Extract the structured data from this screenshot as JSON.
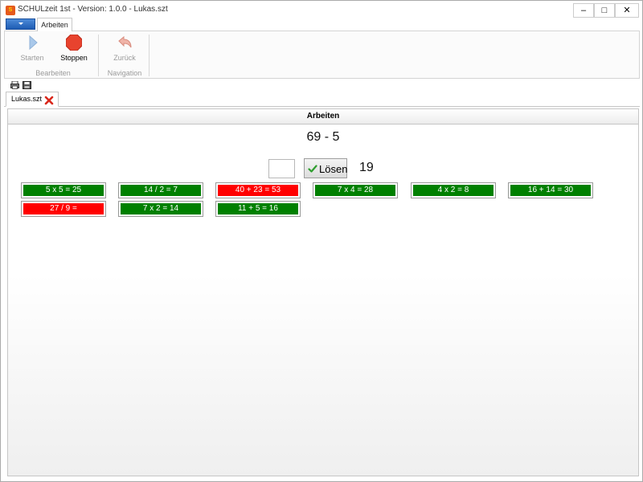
{
  "window": {
    "icon_text": "S",
    "title": "SCHULzeit 1st - Version: 1.0.0 - Lukas.szt",
    "min_glyph": "–",
    "max_glyph": "□",
    "close_glyph": "✕"
  },
  "ribbon": {
    "tab": "Arbeiten",
    "buttons": {
      "start": "Starten",
      "stop": "Stoppen",
      "back": "Zurück"
    },
    "groups": {
      "edit": "Bearbeiten",
      "navigation": "Navigation"
    }
  },
  "document_tab": {
    "label": "Lukas.szt"
  },
  "exercise": {
    "header": "Arbeiten",
    "problem": "69 - 5",
    "answer_value": "",
    "solve_label": "Lösen",
    "counter": "19",
    "results": [
      {
        "text": "5 x 5 = 25",
        "status": "correct"
      },
      {
        "text": "14 / 2 = 7",
        "status": "correct"
      },
      {
        "text": "40 + 23 = 53",
        "status": "wrong"
      },
      {
        "text": "7 x 4 = 28",
        "status": "correct"
      },
      {
        "text": "4 x 2 = 8",
        "status": "correct"
      },
      {
        "text": "16 + 14 = 30",
        "status": "correct"
      },
      {
        "text": "27 / 9 =",
        "status": "wrong"
      },
      {
        "text": "7 x 2 = 14",
        "status": "correct"
      },
      {
        "text": "11 + 5 = 16",
        "status": "correct"
      }
    ]
  },
  "colors": {
    "correct": "#008000",
    "wrong": "#ff0000",
    "stop": "#e8432e"
  }
}
